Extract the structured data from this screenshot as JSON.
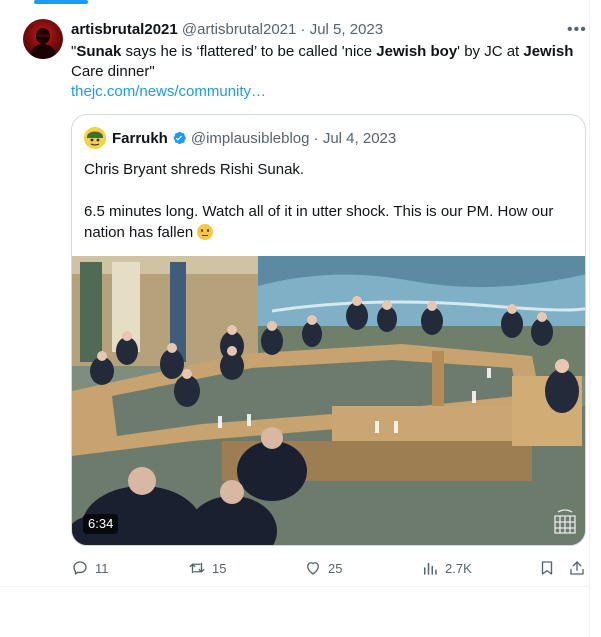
{
  "tweet": {
    "display_name": "artisbrutal2021",
    "handle": "@artisbrutal2021",
    "separator": "·",
    "date": "Jul 5, 2023",
    "more_icon": "ellipsis-icon",
    "text_parts": [
      {
        "t": "\"",
        "bold": false
      },
      {
        "t": "Sunak",
        "bold": true
      },
      {
        "t": " says he is ‘flattered’ to be called 'nice ",
        "bold": false
      },
      {
        "t": "Jewish boy",
        "bold": true
      },
      {
        "t": "' by JC at ",
        "bold": false
      },
      {
        "t": "Jewish",
        "bold": true
      },
      {
        "t": " Care dinner\"",
        "bold": false
      }
    ],
    "link": "thejc.com/news/community…"
  },
  "quote": {
    "display_name": "Farrukh",
    "handle": "@implausibleblog",
    "separator": "·",
    "date": "Jul 4, 2023",
    "line1": "Chris Bryant shreds Rishi Sunak.",
    "line2": "6.5 minutes long. Watch all of it in utter shock. This is our PM. How our nation has fallen",
    "emoji": "confused-face-emoji",
    "video_duration": "6:34",
    "watermark_icon": "portcullis-icon"
  },
  "actions": {
    "replies": "11",
    "reposts": "15",
    "likes": "25",
    "views": "2.7K"
  },
  "colors": {
    "accent": "#1d9bf0",
    "muted": "#536471",
    "verified": "#1d9bf0",
    "border": "#cfd9de"
  }
}
